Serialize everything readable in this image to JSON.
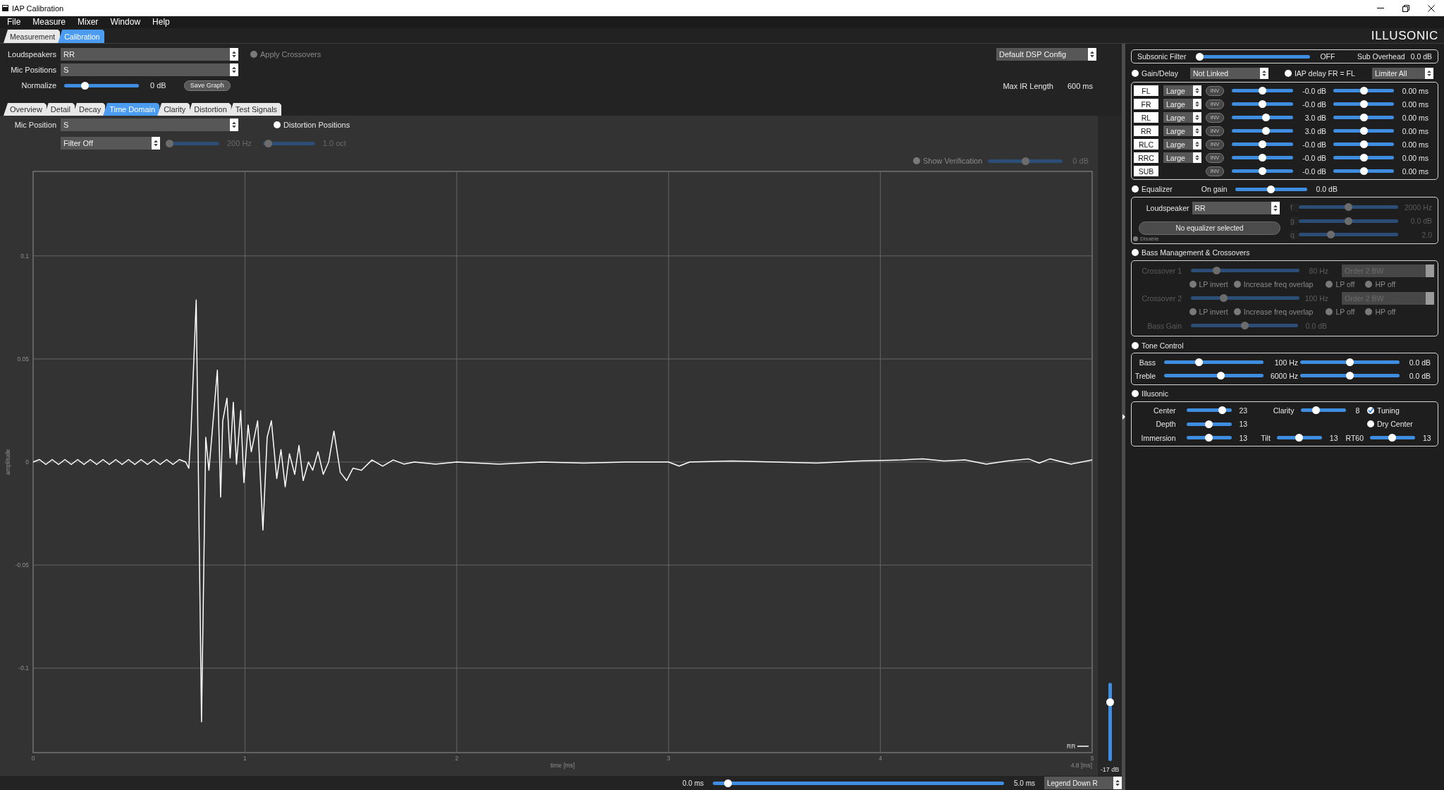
{
  "window": {
    "title": "IAP Calibration"
  },
  "menu": [
    "File",
    "Measure",
    "Mixer",
    "Window",
    "Help"
  ],
  "main_tabs": [
    {
      "label": "Measurement",
      "selected": false
    },
    {
      "label": "Calibration",
      "selected": true
    }
  ],
  "logo": "ILLUSONIC",
  "setup": {
    "loudspeakers": {
      "label": "Loudspeakers",
      "value": "RR"
    },
    "mic_positions": {
      "label": "Mic Positions",
      "value": "S"
    },
    "normalize": {
      "label": "Normalize",
      "level": 0.25,
      "reading": "0 dB"
    },
    "save_graph": "Save Graph",
    "apply_crossovers": {
      "label": "Apply Crossovers",
      "checked": false,
      "disabled": true
    },
    "dsp_config": "Default DSP Config",
    "max_ir_length": {
      "label": "Max IR Length",
      "value": "600 ms"
    }
  },
  "view_tabs": [
    {
      "label": "Overview",
      "selected": false
    },
    {
      "label": "Detail",
      "selected": false
    },
    {
      "label": "Decay",
      "selected": false
    },
    {
      "label": "Time Domain",
      "selected": true
    },
    {
      "label": "Clarity",
      "selected": false
    },
    {
      "label": "Distortion",
      "selected": false
    },
    {
      "label": "Test Signals",
      "selected": false
    }
  ],
  "time_domain": {
    "mic_position": {
      "label": "Mic Position",
      "value": "S"
    },
    "distortion_positions": {
      "label": "Distortion Positions",
      "checked": false,
      "disabled": false
    },
    "filter": "Filter Off",
    "filter_sliders": [
      {
        "level": 0,
        "reading": "200 Hz",
        "disabled": true
      },
      {
        "level": 0.04,
        "reading": "1.0 oct",
        "disabled": true
      }
    ],
    "show_verification": {
      "label": "Show Verification",
      "checked": false,
      "disabled": true,
      "level": 0.5,
      "reading": "0 dB"
    },
    "chart_data": {
      "type": "line",
      "xlabel": "time [ms]",
      "ylabel": "amplitude",
      "grid": true,
      "xlim": [
        0,
        5
      ],
      "ylim": [
        -0.141,
        0.141
      ],
      "xticks": [
        0,
        1,
        2,
        3,
        4,
        5
      ],
      "yticks": [
        -0.1,
        -0.05,
        0,
        0.05,
        0.1
      ],
      "x": [
        0,
        0.03,
        0.06,
        0.09,
        0.12,
        0.15,
        0.18,
        0.21,
        0.24,
        0.27,
        0.3,
        0.33,
        0.36,
        0.39,
        0.42,
        0.45,
        0.48,
        0.51,
        0.54,
        0.57,
        0.6,
        0.63,
        0.66,
        0.69,
        0.72,
        0.735,
        0.745,
        0.77,
        0.795,
        0.815,
        0.83,
        0.845,
        0.87,
        0.885,
        0.895,
        0.915,
        0.93,
        0.945,
        0.96,
        0.98,
        0.995,
        1.015,
        1.03,
        1.06,
        1.085,
        1.105,
        1.125,
        1.15,
        1.17,
        1.19,
        1.21,
        1.235,
        1.255,
        1.275,
        1.3,
        1.32,
        1.345,
        1.37,
        1.395,
        1.42,
        1.45,
        1.48,
        1.51,
        1.55,
        1.6,
        1.65,
        1.7,
        1.75,
        1.8,
        1.9,
        2.0,
        2.2,
        2.4,
        2.6,
        2.8,
        3.0,
        3.05,
        3.1,
        3.3,
        3.5,
        3.7,
        3.9,
        4.1,
        4.2,
        4.3,
        4.4,
        4.5,
        4.6,
        4.7,
        4.75,
        4.8,
        4.9,
        5.0
      ],
      "series": [
        {
          "name": "RR",
          "color": "#ffffff",
          "values": [
            0,
            0.0012,
            -0.0012,
            0.0012,
            -0.0012,
            0.0012,
            -0.0012,
            0.0012,
            -0.0012,
            0.0012,
            -0.0012,
            0.0012,
            -0.0012,
            0.0012,
            -0.0012,
            0.0012,
            -0.0012,
            0.0012,
            -0.0012,
            0.0012,
            -0.0012,
            0.0012,
            -0.0012,
            0.0012,
            0.0,
            -0.003,
            0.014,
            0.0786,
            -0.126,
            0.012,
            -0.004,
            0.014,
            0.0446,
            -0.017,
            0.02,
            0.031,
            0.002,
            0.029,
            -0.001,
            0.025,
            -0.01,
            0.018,
            0.005,
            0.02,
            -0.033,
            0.012,
            0.02,
            -0.008,
            0.006,
            -0.012,
            0.004,
            -0.006,
            0.008,
            -0.009,
            0.0,
            -0.004,
            0.005,
            -0.006,
            0.0,
            0.015,
            -0.005,
            -0.009,
            -0.003,
            -0.004,
            0.001,
            -0.002,
            0.001,
            -0.001,
            0.0,
            -0.001,
            0.0,
            -0.001,
            0.0,
            -0.0005,
            0.0,
            0.0,
            -0.002,
            0.0,
            0.0005,
            0.0,
            -0.0005,
            0.0005,
            0.001,
            0.0015,
            0.0005,
            0.001,
            -0.001,
            0.0005,
            0.0015,
            -0.0005,
            0.0015,
            -0.001,
            0.001
          ]
        }
      ]
    },
    "cursor_reading": "4.8 [ms]",
    "display_gain": {
      "level": 0.78,
      "reading": "-17 dB"
    },
    "time_range": {
      "start": "0.0 ms",
      "level": 0.04,
      "end": "5.0 ms"
    },
    "legend_position": "Legend Down R"
  },
  "dsp": {
    "subsonic": {
      "label": "Subsonic Filter",
      "level": 0,
      "reading": "OFF",
      "overhead_label": "Sub Overhead",
      "overhead": "0.0 dB"
    },
    "gain_delay": {
      "label": "Gain/Delay",
      "checked": false,
      "link": "Not Linked",
      "iap_delay": {
        "label": "IAP delay FR = FL",
        "checked": false
      },
      "limiter": "Limiter All"
    },
    "channels": [
      {
        "name": "FL",
        "size": "Large",
        "invert": "INV",
        "gain": {
          "level": 0.5,
          "reading": "-0.0 dB"
        },
        "delay": {
          "level": 0.5,
          "reading": "0.00 ms"
        }
      },
      {
        "name": "FR",
        "size": "Large",
        "invert": "INV",
        "gain": {
          "level": 0.5,
          "reading": "-0.0 dB"
        },
        "delay": {
          "level": 0.5,
          "reading": "0.00 ms"
        }
      },
      {
        "name": "RL",
        "size": "Large",
        "invert": "INV",
        "gain": {
          "level": 0.57,
          "reading": "3.0 dB"
        },
        "delay": {
          "level": 0.5,
          "reading": "0.00 ms"
        }
      },
      {
        "name": "RR",
        "size": "Large",
        "invert": "INV",
        "gain": {
          "level": 0.57,
          "reading": "3.0 dB"
        },
        "delay": {
          "level": 0.5,
          "reading": "0.00 ms"
        }
      },
      {
        "name": "RLC",
        "size": "Large",
        "invert": "INV",
        "gain": {
          "level": 0.5,
          "reading": "-0.0 dB"
        },
        "delay": {
          "level": 0.5,
          "reading": "0.00 ms"
        }
      },
      {
        "name": "RRC",
        "size": "Large",
        "invert": "INV",
        "gain": {
          "level": 0.5,
          "reading": "-0.0 dB"
        },
        "delay": {
          "level": 0.5,
          "reading": "0.00 ms"
        }
      },
      {
        "name": "SUB",
        "invert": "INV",
        "gain": {
          "level": 0.5,
          "reading": "-0.0 dB"
        },
        "delay": {
          "level": 0.5,
          "reading": "0.00 ms"
        }
      }
    ],
    "equalizer": {
      "label": "Equalizer",
      "checked": false,
      "gain_label": "On gain",
      "level": 0.5,
      "reading": "0.0 dB",
      "loudspeaker_label": "Loudspeaker",
      "loudspeaker": "RR",
      "status": "No equalizer selected",
      "disable": {
        "label": "Disable",
        "checked": false,
        "disabled": true
      },
      "params": [
        {
          "label": "f",
          "level": 0.5,
          "reading": "2000 Hz",
          "disabled": true
        },
        {
          "label": "g",
          "level": 0.5,
          "reading": "0.0 dB",
          "disabled": true
        },
        {
          "label": "q",
          "level": 0.31,
          "reading": "2.0",
          "disabled": true
        }
      ]
    },
    "bass_management": {
      "label": "Bass Management & Crossovers",
      "checked": false,
      "crossovers": [
        {
          "label": "Crossover 1",
          "level": 0.22,
          "reading": "80 Hz",
          "order": "Order 2 BW",
          "disabled": true,
          "options": [
            {
              "label": "LP invert",
              "checked": false
            },
            {
              "label": "Increase freq overlap",
              "checked": false
            },
            {
              "label": "LP off",
              "checked": false
            },
            {
              "label": "HP off",
              "checked": false
            }
          ]
        },
        {
          "label": "Crossover 2",
          "level": 0.29,
          "reading": "100 Hz",
          "order": "Order 2 BW",
          "disabled": true,
          "options": [
            {
              "label": "LP invert",
              "checked": false
            },
            {
              "label": "Increase freq overlap",
              "checked": false
            },
            {
              "label": "LP off",
              "checked": false
            },
            {
              "label": "HP off",
              "checked": false
            }
          ]
        }
      ],
      "bass_gain": {
        "label": "Bass Gain",
        "level": 0.5,
        "reading": "0.0 dB",
        "disabled": true
      }
    },
    "tone_control": {
      "label": "Tone Control",
      "checked": false,
      "bands": [
        {
          "label": "Bass",
          "frequency": {
            "level": 0.34,
            "reading": "100 Hz"
          },
          "gain": {
            "level": 0.5,
            "reading": "0.0 dB"
          }
        },
        {
          "label": "Treble",
          "frequency": {
            "level": 0.58,
            "reading": "6000 Hz"
          },
          "gain": {
            "level": 0.5,
            "reading": "0.0 dB"
          }
        }
      ]
    },
    "illusonic": {
      "label": "Illusonic",
      "checked": false,
      "rows": [
        {
          "items": [
            {
              "kind": "slider",
              "label": "Center",
              "level": 0.85,
              "reading": "23"
            },
            {
              "kind": "slider",
              "label": "Clarity",
              "level": 0.32,
              "reading": "8"
            },
            {
              "kind": "toggle",
              "label": "Tuning",
              "checked": true
            }
          ]
        },
        {
          "items": [
            {
              "kind": "slider",
              "label": "Depth",
              "level": 0.5,
              "reading": "13"
            },
            {
              "kind": "toggle",
              "label": "Dry Center",
              "checked": false
            }
          ]
        },
        {
          "items": [
            {
              "kind": "slider",
              "label": "Immersion",
              "level": 0.5,
              "reading": "13"
            },
            {
              "kind": "slider",
              "label": "Tilt",
              "level": 0.5,
              "reading": "13"
            },
            {
              "kind": "slider",
              "label": "RT60",
              "level": 0.5,
              "reading": "13"
            }
          ]
        }
      ]
    }
  }
}
